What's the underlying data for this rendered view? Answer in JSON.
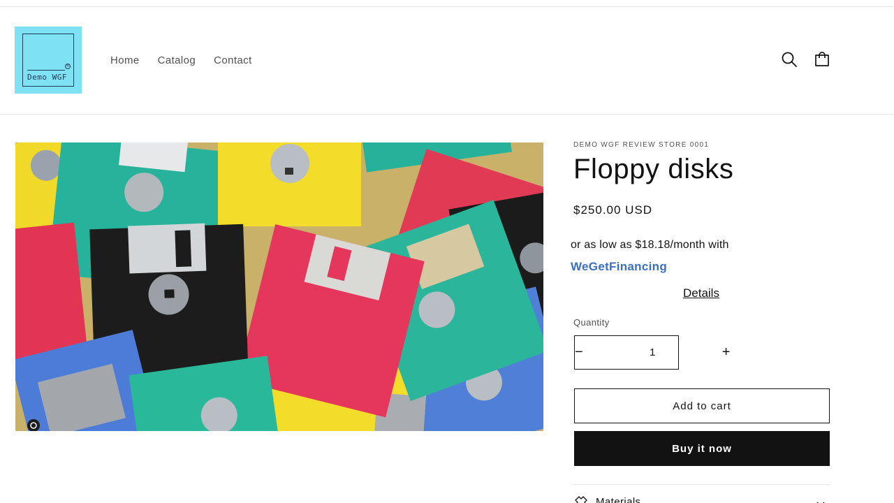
{
  "header": {
    "logo_text": "Demo WGF",
    "nav": [
      {
        "label": "Home"
      },
      {
        "label": "Catalog"
      },
      {
        "label": "Contact"
      }
    ],
    "icons": [
      "search-icon",
      "cart-icon"
    ]
  },
  "product": {
    "vendor": "DEMO WGF REVIEW STORE 0001",
    "title": "Floppy disks",
    "price": "$250.00 USD",
    "financing": {
      "text": "or as low as $18.18/month with",
      "brand": "WeGetFinancing",
      "details_label": "Details"
    },
    "quantity": {
      "label": "Quantity",
      "value": "1",
      "minus": "−",
      "plus": "+"
    },
    "add_to_cart_label": "Add to cart",
    "buy_now_label": "Buy it now",
    "accordion": {
      "label": "Materials",
      "icon": "fabric-icon"
    }
  },
  "colors": {
    "logo_bg": "#7ee1f4",
    "financing_brand": "#3b6fc0",
    "buy_button_bg": "#121212",
    "text": "#121212"
  }
}
